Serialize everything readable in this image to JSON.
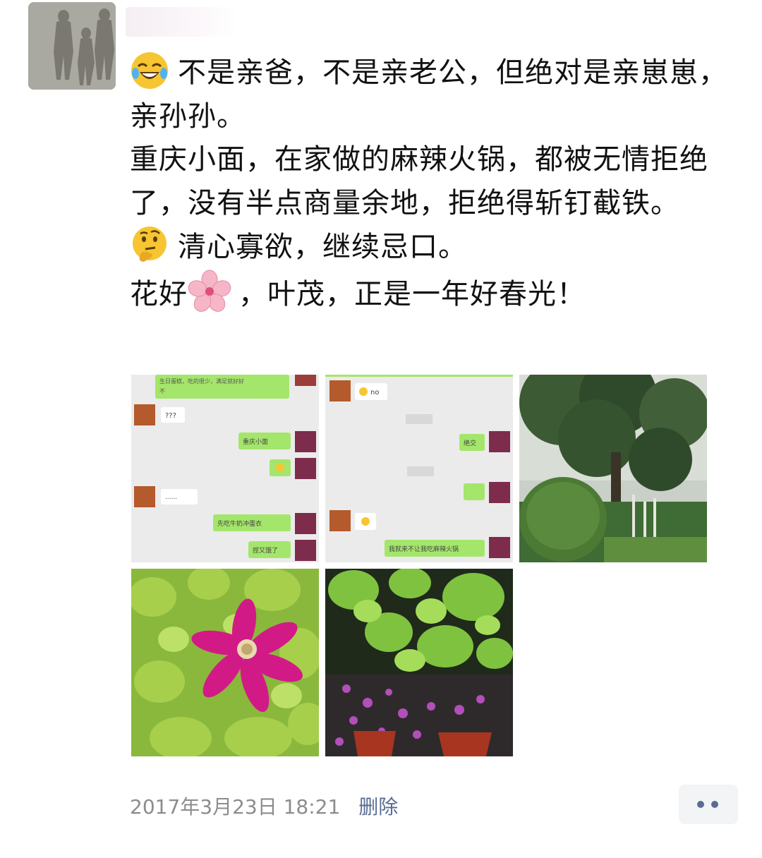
{
  "post": {
    "lines": [
      {
        "emoji": "tears-of-joy-emoji",
        "text": "不是亲爸，不是亲老公，但绝对是亲崽崽，亲孙孙。"
      },
      {
        "emoji": null,
        "text": "重庆小面，在家做的麻辣火锅，都被无情拒绝了，没有半点商量余地，拒绝得斩钉截铁。"
      },
      {
        "emoji": "thinking-face-emoji",
        "text": "清心寡欲，继续忌口。"
      },
      {
        "emoji": null,
        "prefix": "花好",
        "inline_icon": "cherry-blossom-emoji",
        "suffix": "，叶茂，正是一年好春光！"
      }
    ]
  },
  "photos": {
    "chat1": {
      "top_text": "生日蛋糕，吃的很少，满足就好好",
      "top_text2": "不",
      "q_text": "???",
      "msg1": "重庆小面",
      "ellipsis": "......",
      "msg2": "先吃牛奶冲蛋衣",
      "msg3": "捏又饿了"
    },
    "chat2": {
      "no_text": "no",
      "msg1": "绝交",
      "msg2": "我就来不让我吃麻辣火锅"
    },
    "photo_labels": [
      "chat-screenshot-1",
      "chat-screenshot-2",
      "garden-tree-photo",
      "pink-flower-photo",
      "flowerpot-photo"
    ]
  },
  "footer": {
    "timestamp": "2017年3月23日 18:21",
    "delete_label": "删除"
  },
  "colors": {
    "link_blue": "#5a6c93",
    "meta_gray": "#8c8c8c",
    "chat_bg": "#ebebeb",
    "bubble_green": "#9fe658"
  }
}
